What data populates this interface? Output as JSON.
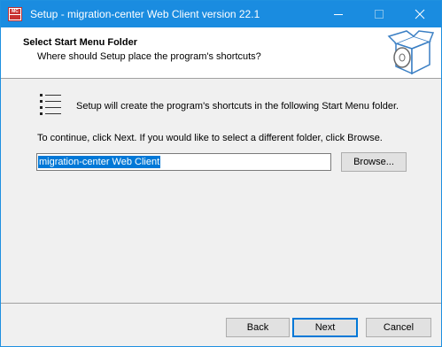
{
  "window": {
    "title": "Setup - migration-center Web Client version 22.1",
    "app_icon_text": "MC"
  },
  "header": {
    "title": "Select Start Menu Folder",
    "subtitle": "Where should Setup place the program's shortcuts?"
  },
  "body": {
    "intro": "Setup will create the program's shortcuts in the following Start Menu folder.",
    "instructions": "To continue, click Next. If you would like to select a different folder, click Browse.",
    "folder_value": "migration-center Web Client",
    "browse_label": "Browse..."
  },
  "footer": {
    "back_label": "Back",
    "next_label": "Next",
    "cancel_label": "Cancel"
  },
  "colors": {
    "titlebar": "#1a8ce0",
    "accent": "#0078d7"
  }
}
